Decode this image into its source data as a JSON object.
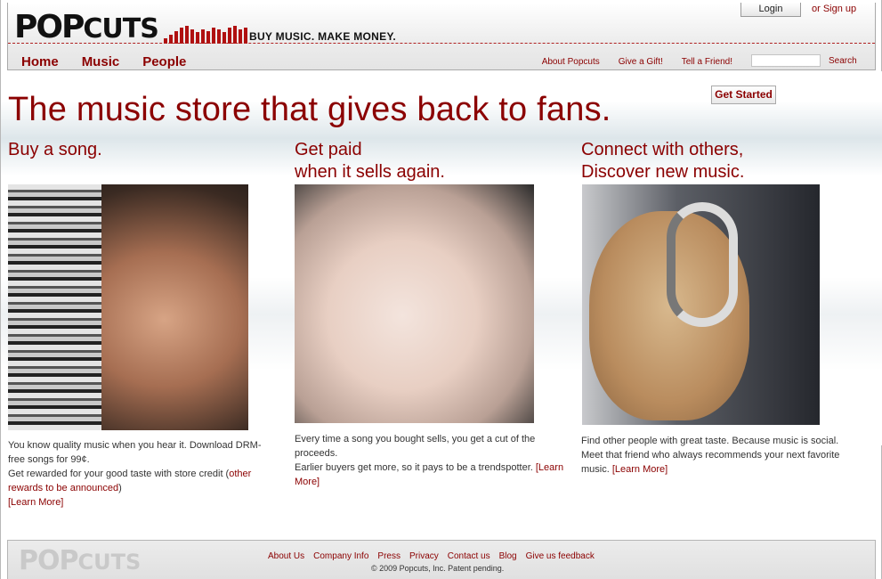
{
  "header": {
    "logo_main": "POP",
    "logo_sub": "CUTS",
    "tagline": "BUY MUSIC. MAKE MONEY.",
    "login_label": "Login",
    "signup_label": "or Sign up",
    "nav": [
      "Home",
      "Music",
      "People"
    ],
    "util_links": [
      "About Popcuts",
      "Give a Gift!",
      "Tell a Friend!"
    ],
    "search_value": "",
    "search_label": "Search"
  },
  "hero": {
    "headline": "The music store that gives back to fans.",
    "get_started_label": "Get Started"
  },
  "columns": [
    {
      "heading_line1": "Buy a song.",
      "heading_line2": "",
      "text1": "You know quality music when you hear it. Download DRM-free songs for 99¢.",
      "text2": "Get rewarded for your good taste with store credit (",
      "link1": "other rewards to be announced",
      "text3": ")",
      "learn_more": "[Learn More]"
    },
    {
      "heading_line1": "Get paid",
      "heading_line2": "when it sells again.",
      "text1": "Every time a song you bought sells, you get a cut of the proceeds.",
      "text2": "Earlier buyers get more, so it pays to be a trendspotter.",
      "learn_more": "[Learn More]"
    },
    {
      "heading_line1": "Connect with others,",
      "heading_line2": "Discover new music.",
      "text1": "Find other people with great taste. Because music is social.",
      "text2": "Meet that friend who always recommends your next favorite music.",
      "learn_more": "[Learn More]"
    }
  ],
  "footer": {
    "logo_main": "POP",
    "logo_sub": "CUTS",
    "links": [
      "About Us",
      "Company Info",
      "Press",
      "Privacy",
      "Contact us",
      "Blog",
      "Give us feedback"
    ],
    "copyright": "© 2009 Popcuts, Inc. Patent pending."
  },
  "colors": {
    "accent": "#8b0000",
    "bars": "#b01010"
  }
}
